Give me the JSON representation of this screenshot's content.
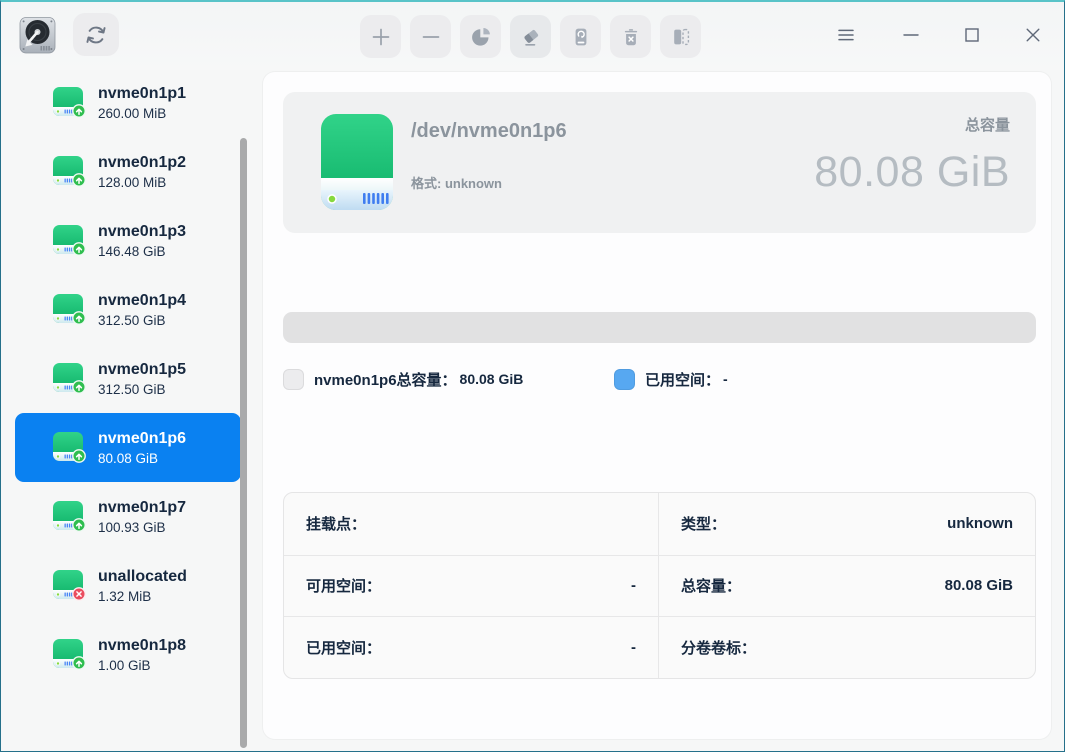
{
  "titlebar": {
    "tool_buttons": [
      {
        "name": "add-partition",
        "icon": "plus-icon"
      },
      {
        "name": "shrink-partition",
        "icon": "minus-icon"
      },
      {
        "name": "partition-usage",
        "icon": "pie-chart-icon"
      },
      {
        "name": "wipe-partition",
        "icon": "eraser-icon"
      },
      {
        "name": "format-partition",
        "icon": "disk-refresh-icon"
      },
      {
        "name": "delete-partition",
        "icon": "trash-icon"
      },
      {
        "name": "clone-partition",
        "icon": "clone-icon"
      }
    ],
    "window_controls": [
      "menu-icon",
      "minimize-icon",
      "maximize-icon",
      "close-icon"
    ]
  },
  "sidebar": {
    "items": [
      {
        "name": "nvme0n1p1",
        "size": "260.00 MiB",
        "status": "ok",
        "selected": false
      },
      {
        "name": "nvme0n1p2",
        "size": "128.00 MiB",
        "status": "ok",
        "selected": false
      },
      {
        "name": "nvme0n1p3",
        "size": "146.48 GiB",
        "status": "ok",
        "selected": false
      },
      {
        "name": "nvme0n1p4",
        "size": "312.50 GiB",
        "status": "ok",
        "selected": false
      },
      {
        "name": "nvme0n1p5",
        "size": "312.50 GiB",
        "status": "ok",
        "selected": false
      },
      {
        "name": "nvme0n1p6",
        "size": "80.08 GiB",
        "status": "ok",
        "selected": true
      },
      {
        "name": "nvme0n1p7",
        "size": "100.93 GiB",
        "status": "ok",
        "selected": false
      },
      {
        "name": "unallocated",
        "size": "1.32 MiB",
        "status": "error",
        "selected": false
      },
      {
        "name": "nvme0n1p8",
        "size": "1.00 GiB",
        "status": "ok",
        "selected": false
      }
    ]
  },
  "main": {
    "header": {
      "device_path": "/dev/nvme0n1p6",
      "format_line": "格式: unknown",
      "capacity_label": "总容量",
      "capacity_value": "80.08 GiB"
    },
    "legend": [
      {
        "label": "nvme0n1p6总容量：",
        "value": "80.08 GiB",
        "color": "#ececee"
      },
      {
        "label": "已用空间：",
        "value": "-",
        "color": "#57a8f1"
      }
    ],
    "details": {
      "cells": [
        {
          "label": "挂载点：",
          "value": ""
        },
        {
          "label": "类型：",
          "value": "unknown"
        },
        {
          "label": "可用空间：",
          "value": "-"
        },
        {
          "label": "总容量：",
          "value": "80.08 GiB"
        },
        {
          "label": "已用空间：",
          "value": "-"
        },
        {
          "label": "分卷卷标：",
          "value": ""
        }
      ]
    }
  },
  "colors": {
    "accent_blue": "#0a81f1",
    "disk_green": "#14b869",
    "badge_ok": "#2fbe4f",
    "badge_error": "#ea4d5f",
    "window_border": "#58c3c8"
  }
}
